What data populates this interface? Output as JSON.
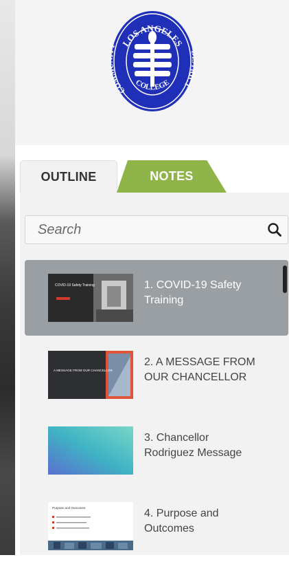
{
  "logo": {
    "text_top": "LOS ANGELES",
    "text_left": "COMMUNITY",
    "text_right": "DISTRICT",
    "text_bottom": "COLLEGE"
  },
  "tabs": [
    {
      "label": "OUTLINE",
      "active": true
    },
    {
      "label": "NOTES",
      "active": false
    }
  ],
  "search": {
    "placeholder": "Search"
  },
  "slides": [
    {
      "label": "1. COVID-19 Safety Training",
      "line1": "1. COVID-19 Safety",
      "line2": "Training",
      "thumb_text": "COVID-19 Safety Training",
      "active": true
    },
    {
      "label": "2. A MESSAGE FROM OUR CHANCELLOR",
      "line1": "2. A MESSAGE FROM",
      "line2": "OUR CHANCELLOR",
      "thumb_text": "A MESSAGE FROM OUR CHANCELLOR",
      "active": false
    },
    {
      "label": "3. Chancellor Rodriguez Message",
      "line1": "3. Chancellor",
      "line2": "Rodriguez Message",
      "active": false
    },
    {
      "label": "4. Purpose and Outcomes",
      "line1": "4. Purpose and",
      "line2": "Outcomes",
      "thumb_text": "Purpose and Outcomes",
      "active": false
    }
  ],
  "colors": {
    "notes_tab": "#8fb44a",
    "active_row": "#9a9fa3",
    "logo_blue": "#1f2fb8"
  }
}
